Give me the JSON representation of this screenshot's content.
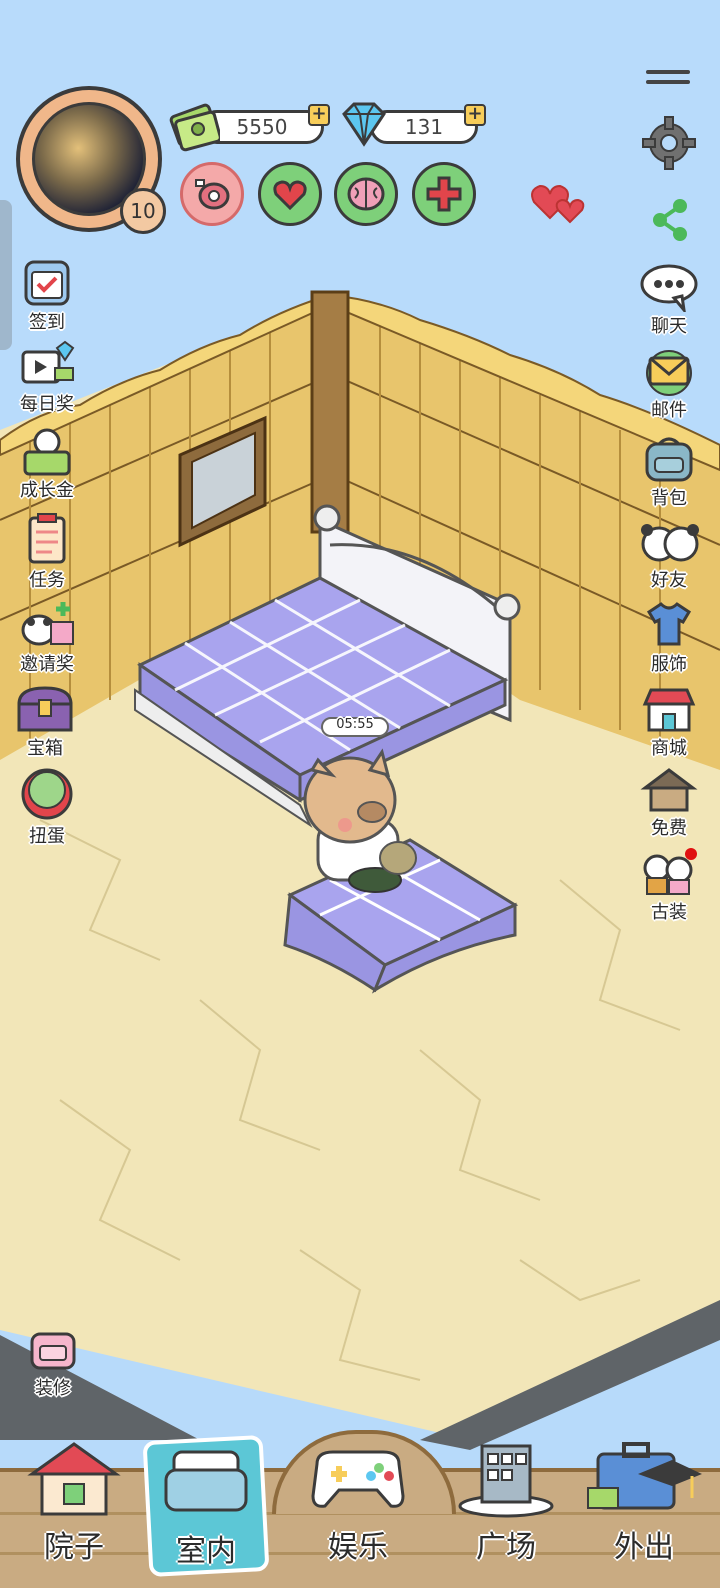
{
  "profile": {
    "level": "10"
  },
  "currency": {
    "cash": "5550",
    "diamonds": "131"
  },
  "stats": [
    {
      "icon": "meat-icon",
      "color": "#f4a9a9"
    },
    {
      "icon": "heart-icon",
      "color": "#7ed07a"
    },
    {
      "icon": "brain-icon",
      "color": "#7ed07a"
    },
    {
      "icon": "plus-health-icon",
      "color": "#7ed07a"
    }
  ],
  "left_menu": [
    {
      "label": "签到",
      "icon": "checkin-icon"
    },
    {
      "label": "每日奖",
      "icon": "daily-video-icon"
    },
    {
      "label": "成长金",
      "icon": "growth-fund-icon"
    },
    {
      "label": "任务",
      "icon": "task-icon"
    },
    {
      "label": "邀请奖",
      "icon": "invite-icon"
    },
    {
      "label": "宝箱",
      "icon": "treasure-chest-icon"
    },
    {
      "label": "扭蛋",
      "icon": "gacha-icon"
    }
  ],
  "right_menu": [
    {
      "label": "聊天",
      "icon": "chat-icon"
    },
    {
      "label": "邮件",
      "icon": "mail-icon"
    },
    {
      "label": "背包",
      "icon": "backpack-icon"
    },
    {
      "label": "好友",
      "icon": "friends-icon"
    },
    {
      "label": "服饰",
      "icon": "clothes-icon"
    },
    {
      "label": "商城",
      "icon": "shop-icon"
    },
    {
      "label": "免费",
      "icon": "free-house-icon"
    },
    {
      "label": "古装",
      "icon": "costume-icon"
    }
  ],
  "decorate": {
    "label": "装修"
  },
  "timer": "05:55",
  "bottom_nav": [
    {
      "label": "院子",
      "icon": "house-icon"
    },
    {
      "label": "室内",
      "icon": "bed-icon",
      "active": true
    },
    {
      "label": "娱乐",
      "icon": "gamepad-icon"
    },
    {
      "label": "广场",
      "icon": "building-icon"
    },
    {
      "label": "外出",
      "icon": "suitcase-icon"
    }
  ],
  "colors": {
    "sky": "#b8dbfb",
    "floor": "#f2e6b8",
    "wall": "#e8c56c",
    "bedsheet": "#a9a4ee",
    "accent_active": "#5cc7d6"
  }
}
